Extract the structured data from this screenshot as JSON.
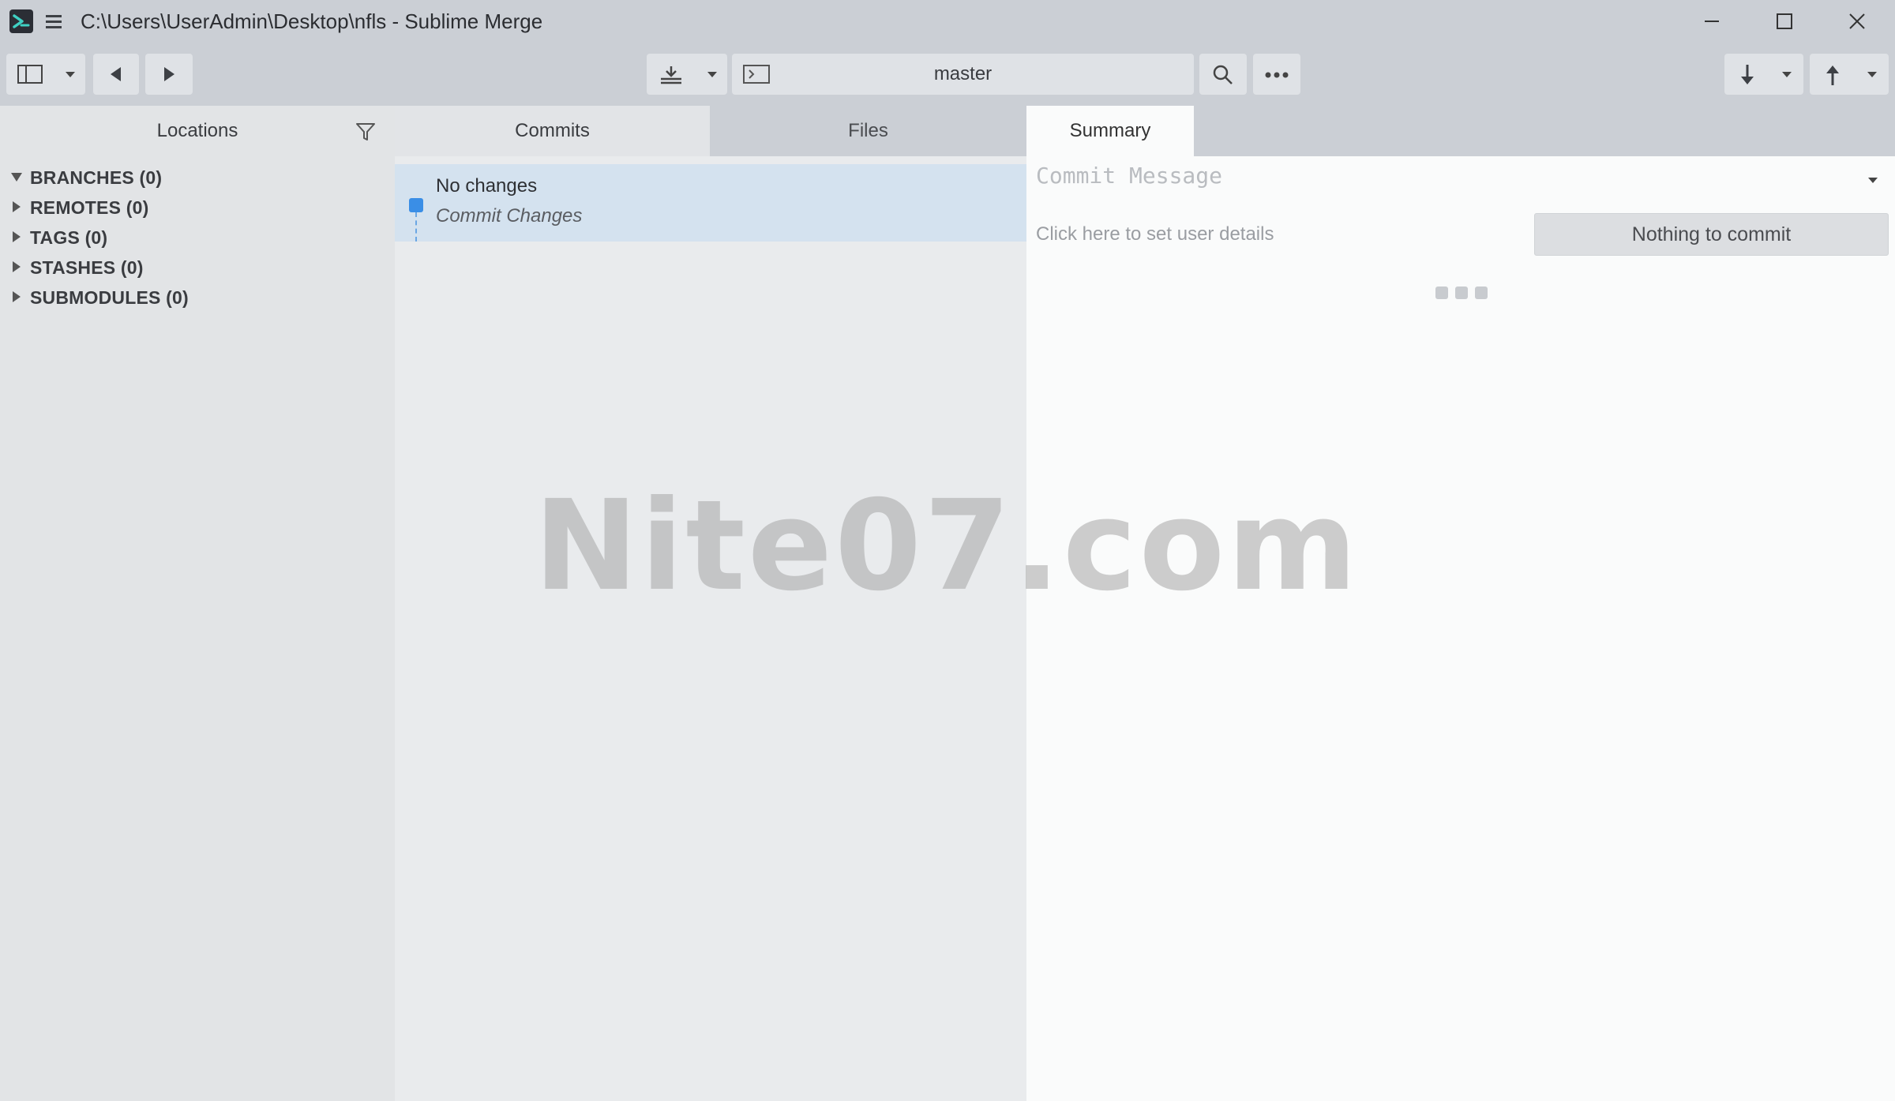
{
  "window": {
    "title": "C:\\Users\\UserAdmin\\Desktop\\nfls - Sublime Merge",
    "controls": [
      "minimize-icon",
      "maximize-icon",
      "close-icon"
    ]
  },
  "toolbar": {
    "branch": "master",
    "left_buttons": [
      "sidebar-toggle-icon",
      "chevron-down-icon",
      "back-arrow-icon",
      "forward-arrow-icon"
    ],
    "center_buttons": [
      "stash-icon",
      "chevron-down-icon",
      "terminal-icon",
      "search-icon",
      "more-icon"
    ],
    "right_buttons": [
      "pull-icon",
      "chevron-down-icon",
      "push-icon",
      "chevron-down-icon"
    ]
  },
  "sidebar": {
    "title": "Locations",
    "items": [
      {
        "label": "BRANCHES (0)",
        "expanded": true
      },
      {
        "label": "REMOTES (0)",
        "expanded": false
      },
      {
        "label": "TAGS (0)",
        "expanded": false
      },
      {
        "label": "STASHES (0)",
        "expanded": false
      },
      {
        "label": "SUBMODULES (0)",
        "expanded": false
      }
    ]
  },
  "tabs": {
    "commits": "Commits",
    "files": "Files",
    "summary": "Summary",
    "active": "Summary"
  },
  "commits": {
    "items": [
      {
        "title": "No changes",
        "subtitle": "Commit Changes"
      }
    ]
  },
  "summary": {
    "message_placeholder": "Commit Message",
    "user_details": "Click here to set user details",
    "commit_button": "Nothing to commit"
  },
  "watermark": "Nite07.com",
  "colors": {
    "accent": "#3a8ee6",
    "chrome": "#cbcfd5",
    "selected_row": "#d4e2ef"
  }
}
